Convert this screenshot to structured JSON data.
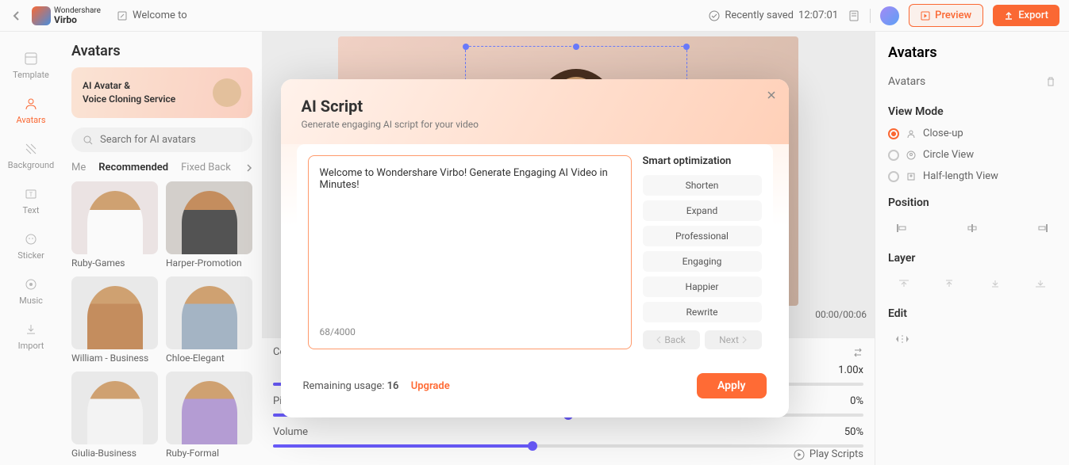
{
  "topbar": {
    "brand_top": "Wondershare",
    "brand_bottom": "Virbo",
    "welcome": "Welcome to",
    "saved_prefix": "Recently saved",
    "saved_time": "12:07:01",
    "preview": "Preview",
    "export": "Export"
  },
  "rail": {
    "items": [
      {
        "icon": "template",
        "label": "Template"
      },
      {
        "icon": "avatars",
        "label": "Avatars"
      },
      {
        "icon": "background",
        "label": "Background"
      },
      {
        "icon": "text",
        "label": "Text"
      },
      {
        "icon": "sticker",
        "label": "Sticker"
      },
      {
        "icon": "music",
        "label": "Music"
      },
      {
        "icon": "import",
        "label": "Import"
      }
    ]
  },
  "left": {
    "title": "Avatars",
    "banner_line1": "AI Avatar &",
    "banner_line2": "Voice Cloning Service",
    "search_placeholder": "Search for AI avatars",
    "tabs": [
      "Me",
      "Recommended",
      "Fixed Back"
    ],
    "avatars": [
      {
        "name": "Ruby-Games",
        "bg": "#f0e8e8",
        "shirt": "#fff"
      },
      {
        "name": "Harper-Promotion",
        "bg": "#d8d4d0",
        "shirt": "#666"
      },
      {
        "name": "William - Business",
        "bg": "#fff",
        "shirt": "#c89060"
      },
      {
        "name": "Chloe-Elegant",
        "bg": "#fff",
        "shirt": "#a8b8c8"
      },
      {
        "name": "Giulia-Business",
        "bg": "#fff",
        "shirt": "#f8f8f8"
      },
      {
        "name": "Ruby-Formal",
        "bg": "#fff",
        "shirt": "#b8a0d8"
      }
    ]
  },
  "canvas": {
    "time": "00:00/00:06"
  },
  "controls": {
    "voice_name": "Cora",
    "speed_label": "",
    "speed_value": "1.00x",
    "pitch_label": "Pitch",
    "pitch_value": "0%",
    "volume_label": "Volume",
    "volume_value": "50%",
    "play_scripts": "Play Scripts"
  },
  "right": {
    "title": "Avatars",
    "section_title": "Avatars",
    "view_mode_label": "View Mode",
    "views": [
      {
        "label": "Close-up",
        "checked": true
      },
      {
        "label": "Circle View",
        "checked": false
      },
      {
        "label": "Half-length View",
        "checked": false
      }
    ],
    "position_label": "Position",
    "layer_label": "Layer",
    "edit_label": "Edit"
  },
  "modal": {
    "title": "AI Script",
    "subtitle": "Generate engaging AI script for your video",
    "script_text": "Welcome to Wondershare Virbo! Generate Engaging AI Video in Minutes!",
    "char_count": "68/4000",
    "opt_title": "Smart optimization",
    "options": [
      "Shorten",
      "Expand",
      "Professional",
      "Engaging",
      "Happier",
      "Rewrite"
    ],
    "back": "Back",
    "next": "Next",
    "usage_label": "Remaining usage:",
    "usage_count": "16",
    "upgrade": "Upgrade",
    "apply": "Apply"
  }
}
